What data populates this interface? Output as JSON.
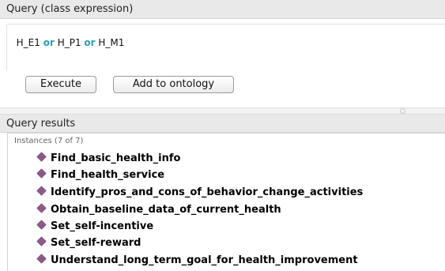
{
  "query_panel": {
    "title": "Query (class expression)",
    "expression": [
      {
        "text": "H_E1 ",
        "keyword": false
      },
      {
        "text": "or",
        "keyword": true
      },
      {
        "text": " H_P1 ",
        "keyword": false
      },
      {
        "text": "or",
        "keyword": true
      },
      {
        "text": " H_M1",
        "keyword": false
      }
    ],
    "execute_label": "Execute",
    "add_label": "Add to ontology"
  },
  "results_panel": {
    "title": "Query results",
    "instances_label": "Instances (7 of 7)",
    "instances": [
      "Find_basic_health_info",
      "Find_health_service",
      "Identify_pros_and_cons_of_behavior_change_activities",
      "Obtain_baseline_data_of_current_health",
      "Set_self-incentive",
      "Set_self-reward",
      "Understand_long_term_goal_for_health_improvement"
    ]
  },
  "colors": {
    "keyword": "#27a0b4",
    "instance_icon": "#8a5a88",
    "header_bg": "#e9e9e9"
  },
  "icons": {
    "instance": "individual-diamond-icon"
  }
}
